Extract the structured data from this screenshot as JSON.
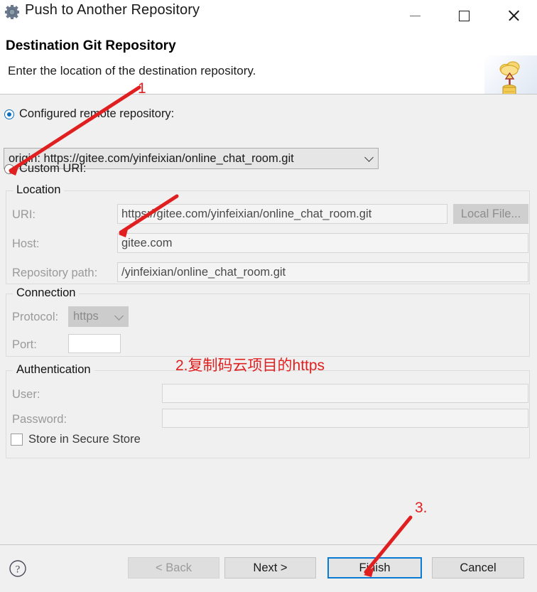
{
  "window": {
    "title": "Push to Another Repository",
    "icon": "gear-icon",
    "minimize_label": "Minimize",
    "maximize_label": "Maximize",
    "close_label": "Close"
  },
  "header": {
    "title": "Destination Git Repository",
    "description": "Enter the location of the destination repository.",
    "banner_icon": "cloud-upload-database-icon"
  },
  "source": {
    "configured_label": "Configured remote repository:",
    "configured_selected": true,
    "combo_value": "origin: https://gitee.com/yinfeixian/online_chat_room.git",
    "custom_uri_label": "Custom URI:",
    "custom_uri_selected": false
  },
  "location": {
    "group_title": "Location",
    "uri_label": "URI:",
    "uri_value": "https://gitee.com/yinfeixian/online_chat_room.git",
    "local_file_button": "Local File...",
    "host_label": "Host:",
    "host_value": "gitee.com",
    "repo_path_label": "Repository path:",
    "repo_path_value": "/yinfeixian/online_chat_room.git"
  },
  "connection": {
    "group_title": "Connection",
    "protocol_label": "Protocol:",
    "protocol_value": "https",
    "port_label": "Port:",
    "port_value": ""
  },
  "authentication": {
    "group_title": "Authentication",
    "user_label": "User:",
    "user_value": "",
    "password_label": "Password:",
    "password_value": "",
    "store_label": "Store in Secure Store",
    "store_checked": false
  },
  "footer": {
    "help_icon": "help-question-icon",
    "back_label": "< Back",
    "back_enabled": false,
    "next_label": "Next >",
    "finish_label": "Finish",
    "finish_default": true,
    "cancel_label": "Cancel"
  },
  "annotations": {
    "color": "#e02020",
    "step1": "1",
    "step2": "2.复制码云项目的https",
    "step3": "3."
  }
}
